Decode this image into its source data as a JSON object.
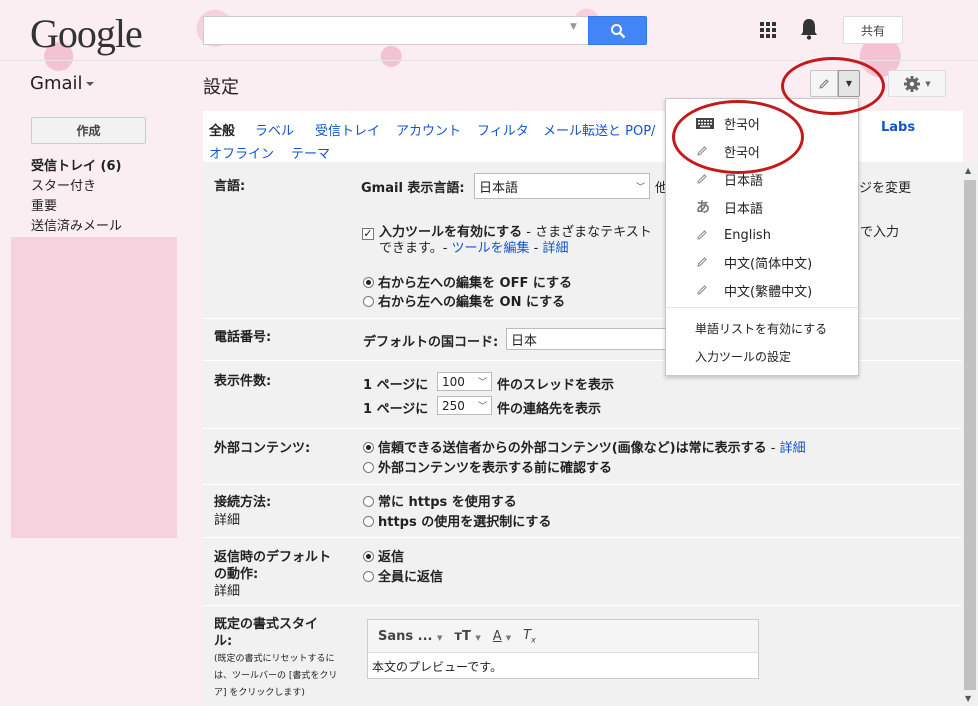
{
  "header": {
    "logo": "Google",
    "share": "共有"
  },
  "left_header": {
    "app": "Gmail"
  },
  "page_title": "設定",
  "nav": {
    "compose": "作成",
    "inbox": "受信トレイ (6)",
    "starred": "スター付き",
    "important": "重要",
    "sent": "送信済みメール"
  },
  "tabs": {
    "row1": [
      "全般",
      "ラベル",
      "受信トレイ",
      "アカウント",
      "フィルタ",
      "メール転送と POP/"
    ],
    "labs": "Labs",
    "row2": [
      "オフライン",
      "テーマ"
    ]
  },
  "settings": {
    "language": {
      "label": "言語:",
      "sub": "Gmail 表示言語:",
      "value": "日本語",
      "other_link": "他",
      "change_link": "ジを変更",
      "input_tools_bold": "入力ツールを有効にする",
      "input_tools_desc": " - さまざまなテキスト",
      "input_tools_tail": "で入力",
      "input_tools_line2": "できます。- ",
      "edit_tools": "ツールを編集",
      "sep": " - ",
      "details": "詳細",
      "rtl_off": "右から左への編集を OFF にする",
      "rtl_on": "右から左への編集を ON にする"
    },
    "phone": {
      "label": "電話番号:",
      "sub": "デフォルトの国コード:",
      "value": "日本"
    },
    "page_size": {
      "label": "表示件数:",
      "prefix": "1 ページに",
      "threads_value": "100",
      "threads_suffix": "件のスレッドを表示",
      "contacts_value": "250",
      "contacts_suffix": "件の連絡先を表示"
    },
    "external": {
      "label": "外部コンテンツ:",
      "opt1": "信頼できる送信者からの外部コンテンツ(画像など)は常に表示する",
      "opt1_sep": " - ",
      "opt1_link": "詳細",
      "opt2": "外部コンテンツを表示する前に確認する"
    },
    "connection": {
      "label": "接続方法:",
      "link": "詳細",
      "opt1": "常に https を使用する",
      "opt2": "https の使用を選択制にする"
    },
    "reply": {
      "label1": "返信時のデフォルト",
      "label2": "の動作:",
      "link": "詳細",
      "opt1": "返信",
      "opt2": "全員に返信"
    },
    "text_style": {
      "label1": "既定の書式スタイ",
      "label2": "ル:",
      "note1": "(既定の書式にリセットするに",
      "note2": "は、ツールバーの [書式をクリ",
      "note3": "ア] をクリックします)",
      "font": "Sans ...",
      "preview": "本文のプレビューです。"
    }
  },
  "menu": {
    "items": [
      {
        "icon": "keyboard-icon",
        "label": "한국어"
      },
      {
        "icon": "pencil-icon",
        "label": "한국어"
      },
      {
        "icon": "pencil-icon",
        "label": "日本語"
      },
      {
        "icon": "hiragana-a-icon",
        "label": "日本語"
      },
      {
        "icon": "pencil-icon",
        "label": "English"
      },
      {
        "icon": "pencil-icon",
        "label": "中文(简体中文)"
      },
      {
        "icon": "pencil-icon",
        "label": "中文(繁體中文)"
      }
    ],
    "hiragana_glyph": "あ",
    "enable_word_list": "単語リストを有効にする",
    "input_tool_settings": "入力ツールの設定"
  },
  "colors": {
    "accent": "#4285f4",
    "link": "#1155cc",
    "annotation": "#c41a1a"
  }
}
